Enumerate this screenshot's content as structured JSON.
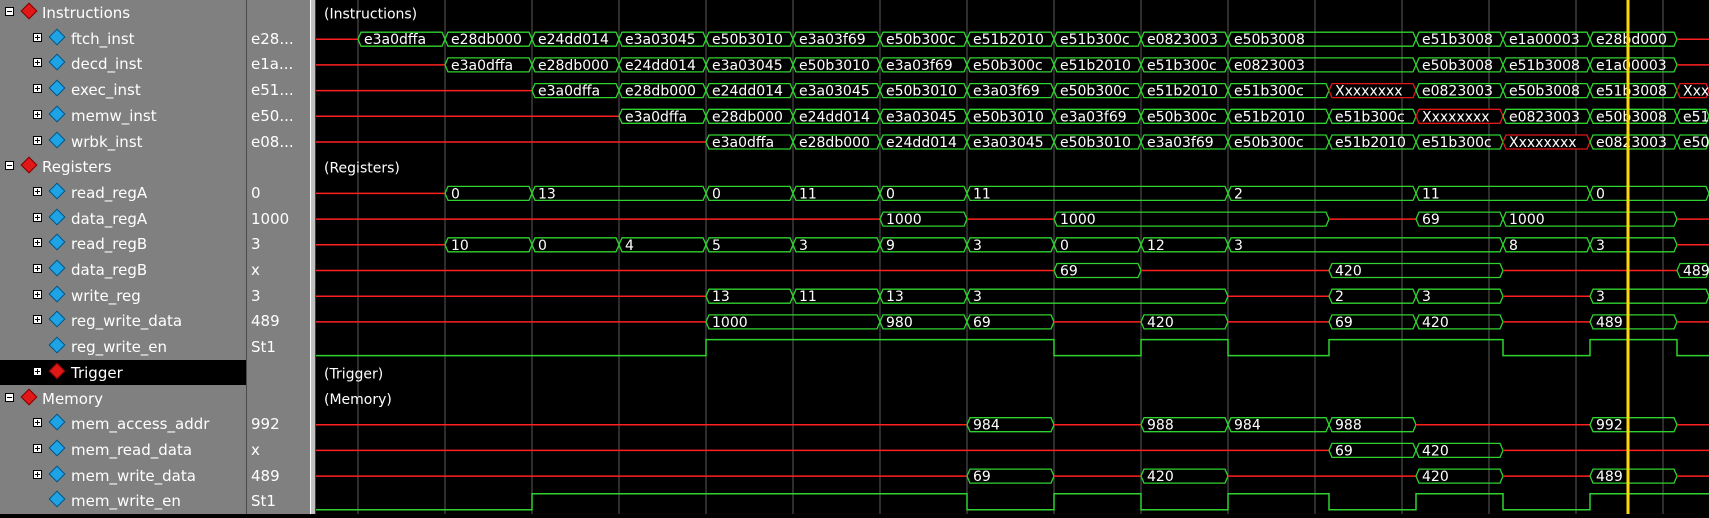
{
  "groups": {
    "instructions": "Instructions",
    "registers": "Registers",
    "trigger": "Trigger",
    "memory": "Memory"
  },
  "wave_labels": {
    "instructions": "(Instructions)",
    "registers": "(Registers)",
    "trigger": "(Trigger)",
    "memory": "(Memory)"
  },
  "signals": {
    "ftch_inst": {
      "name": "ftch_inst",
      "value": "e28...",
      "segments": [
        {
          "start": 42,
          "end": 129,
          "text": "e3a0dffa"
        },
        {
          "start": 129,
          "end": 216,
          "text": "e28db000"
        },
        {
          "start": 216,
          "end": 303,
          "text": "e24dd014"
        },
        {
          "start": 303,
          "end": 390,
          "text": "e3a03045"
        },
        {
          "start": 390,
          "end": 477,
          "text": "e50b3010"
        },
        {
          "start": 477,
          "end": 564,
          "text": "e3a03f69"
        },
        {
          "start": 564,
          "end": 651,
          "text": "e50b300c"
        },
        {
          "start": 651,
          "end": 738,
          "text": "e51b2010"
        },
        {
          "start": 738,
          "end": 825,
          "text": "e51b300c"
        },
        {
          "start": 825,
          "end": 912,
          "text": "e0823003"
        },
        {
          "start": 912,
          "end": 1100,
          "text": "e50b3008"
        },
        {
          "start": 1100,
          "end": 1187,
          "text": "e51b3008"
        },
        {
          "start": 1187,
          "end": 1274,
          "text": "e1a00003"
        },
        {
          "start": 1274,
          "end": 1361,
          "text": "e28bd000"
        }
      ]
    },
    "decd_inst": {
      "name": "decd_inst",
      "value": "e1a...",
      "segments": [
        {
          "start": 129,
          "end": 216,
          "text": "e3a0dffa"
        },
        {
          "start": 216,
          "end": 303,
          "text": "e28db000"
        },
        {
          "start": 303,
          "end": 390,
          "text": "e24dd014"
        },
        {
          "start": 390,
          "end": 477,
          "text": "e3a03045"
        },
        {
          "start": 477,
          "end": 564,
          "text": "e50b3010"
        },
        {
          "start": 564,
          "end": 651,
          "text": "e3a03f69"
        },
        {
          "start": 651,
          "end": 738,
          "text": "e50b300c"
        },
        {
          "start": 738,
          "end": 825,
          "text": "e51b2010"
        },
        {
          "start": 825,
          "end": 912,
          "text": "e51b300c"
        },
        {
          "start": 912,
          "end": 1100,
          "text": "e0823003"
        },
        {
          "start": 1100,
          "end": 1187,
          "text": "e50b3008"
        },
        {
          "start": 1187,
          "end": 1274,
          "text": "e51b3008"
        },
        {
          "start": 1274,
          "end": 1361,
          "text": "e1a00003"
        }
      ]
    },
    "exec_inst": {
      "name": "exec_inst",
      "value": "e51...",
      "segments": [
        {
          "start": 216,
          "end": 303,
          "text": "e3a0dffa"
        },
        {
          "start": 303,
          "end": 390,
          "text": "e28db000"
        },
        {
          "start": 390,
          "end": 477,
          "text": "e24dd014"
        },
        {
          "start": 477,
          "end": 564,
          "text": "e3a03045"
        },
        {
          "start": 564,
          "end": 651,
          "text": "e50b3010"
        },
        {
          "start": 651,
          "end": 738,
          "text": "e3a03f69"
        },
        {
          "start": 738,
          "end": 825,
          "text": "e50b300c"
        },
        {
          "start": 825,
          "end": 912,
          "text": "e51b2010"
        },
        {
          "start": 912,
          "end": 1013,
          "text": "e51b300c"
        },
        {
          "start": 1013,
          "end": 1100,
          "text": "Xxxxxxxx",
          "x": true
        },
        {
          "start": 1100,
          "end": 1187,
          "text": "e0823003"
        },
        {
          "start": 1187,
          "end": 1274,
          "text": "e50b3008"
        },
        {
          "start": 1274,
          "end": 1361,
          "text": "e51b3008"
        },
        {
          "start": 1361,
          "end": 1393,
          "text": "Xxxxxxxx",
          "x": true
        }
      ]
    },
    "memw_inst": {
      "name": "memw_inst",
      "value": "e50...",
      "segments": [
        {
          "start": 303,
          "end": 390,
          "text": "e3a0dffa"
        },
        {
          "start": 390,
          "end": 477,
          "text": "e28db000"
        },
        {
          "start": 477,
          "end": 564,
          "text": "e24dd014"
        },
        {
          "start": 564,
          "end": 651,
          "text": "e3a03045"
        },
        {
          "start": 651,
          "end": 738,
          "text": "e50b3010"
        },
        {
          "start": 738,
          "end": 825,
          "text": "e3a03f69"
        },
        {
          "start": 825,
          "end": 912,
          "text": "e50b300c"
        },
        {
          "start": 912,
          "end": 1013,
          "text": "e51b2010"
        },
        {
          "start": 1013,
          "end": 1100,
          "text": "e51b300c"
        },
        {
          "start": 1100,
          "end": 1187,
          "text": "Xxxxxxxx",
          "x": true
        },
        {
          "start": 1187,
          "end": 1274,
          "text": "e0823003"
        },
        {
          "start": 1274,
          "end": 1361,
          "text": "e50b3008"
        },
        {
          "start": 1361,
          "end": 1393,
          "text": "e51b3008"
        }
      ]
    },
    "wrbk_inst": {
      "name": "wrbk_inst",
      "value": "e08...",
      "segments": [
        {
          "start": 390,
          "end": 477,
          "text": "e3a0dffa"
        },
        {
          "start": 477,
          "end": 564,
          "text": "e28db000"
        },
        {
          "start": 564,
          "end": 651,
          "text": "e24dd014"
        },
        {
          "start": 651,
          "end": 738,
          "text": "e3a03045"
        },
        {
          "start": 738,
          "end": 825,
          "text": "e50b3010"
        },
        {
          "start": 825,
          "end": 912,
          "text": "e3a03f69"
        },
        {
          "start": 912,
          "end": 1013,
          "text": "e50b300c"
        },
        {
          "start": 1013,
          "end": 1100,
          "text": "e51b2010"
        },
        {
          "start": 1100,
          "end": 1187,
          "text": "e51b300c"
        },
        {
          "start": 1187,
          "end": 1274,
          "text": "Xxxxxxxx",
          "x": true
        },
        {
          "start": 1274,
          "end": 1361,
          "text": "e0823003"
        },
        {
          "start": 1361,
          "end": 1393,
          "text": "e50b3008"
        }
      ]
    },
    "read_regA": {
      "name": "read_regA",
      "value": "0",
      "segments": [
        {
          "start": 129,
          "end": 216,
          "text": "0"
        },
        {
          "start": 216,
          "end": 390,
          "text": "13"
        },
        {
          "start": 390,
          "end": 477,
          "text": "0"
        },
        {
          "start": 477,
          "end": 564,
          "text": "11"
        },
        {
          "start": 564,
          "end": 651,
          "text": "0"
        },
        {
          "start": 651,
          "end": 912,
          "text": "11"
        },
        {
          "start": 912,
          "end": 1100,
          "text": "2"
        },
        {
          "start": 1100,
          "end": 1274,
          "text": "11"
        },
        {
          "start": 1274,
          "end": 1393,
          "text": "0"
        }
      ]
    },
    "data_regA": {
      "name": "data_regA",
      "value": "1000",
      "segments": [
        {
          "start": 564,
          "end": 651,
          "text": "1000"
        },
        {
          "start": 738,
          "end": 1013,
          "text": "1000"
        },
        {
          "start": 1100,
          "end": 1187,
          "text": "69"
        },
        {
          "start": 1187,
          "end": 1361,
          "text": "1000"
        }
      ]
    },
    "read_regB": {
      "name": "read_regB",
      "value": "3",
      "segments": [
        {
          "start": 129,
          "end": 216,
          "text": "10"
        },
        {
          "start": 216,
          "end": 303,
          "text": "0"
        },
        {
          "start": 303,
          "end": 390,
          "text": "4"
        },
        {
          "start": 390,
          "end": 477,
          "text": "5"
        },
        {
          "start": 477,
          "end": 564,
          "text": "3"
        },
        {
          "start": 564,
          "end": 651,
          "text": "9"
        },
        {
          "start": 651,
          "end": 738,
          "text": "3"
        },
        {
          "start": 738,
          "end": 825,
          "text": "0"
        },
        {
          "start": 825,
          "end": 912,
          "text": "12"
        },
        {
          "start": 912,
          "end": 1187,
          "text": "3"
        },
        {
          "start": 1187,
          "end": 1274,
          "text": "8"
        },
        {
          "start": 1274,
          "end": 1361,
          "text": "3"
        }
      ]
    },
    "data_regB": {
      "name": "data_regB",
      "value": "x",
      "segments": [
        {
          "start": 738,
          "end": 825,
          "text": "69"
        },
        {
          "start": 1013,
          "end": 1187,
          "text": "420"
        },
        {
          "start": 1361,
          "end": 1393,
          "text": "489"
        }
      ]
    },
    "write_reg": {
      "name": "write_reg",
      "value": "3",
      "segments": [
        {
          "start": 390,
          "end": 477,
          "text": "13"
        },
        {
          "start": 477,
          "end": 564,
          "text": "11"
        },
        {
          "start": 564,
          "end": 651,
          "text": "13"
        },
        {
          "start": 651,
          "end": 912,
          "text": "3"
        },
        {
          "start": 1013,
          "end": 1100,
          "text": "2"
        },
        {
          "start": 1100,
          "end": 1187,
          "text": "3"
        },
        {
          "start": 1274,
          "end": 1393,
          "text": "3"
        }
      ]
    },
    "reg_write_data": {
      "name": "reg_write_data",
      "value": "489",
      "segments": [
        {
          "start": 390,
          "end": 564,
          "text": "1000"
        },
        {
          "start": 564,
          "end": 651,
          "text": "980"
        },
        {
          "start": 651,
          "end": 738,
          "text": "69"
        },
        {
          "start": 825,
          "end": 912,
          "text": "420"
        },
        {
          "start": 1013,
          "end": 1100,
          "text": "69"
        },
        {
          "start": 1100,
          "end": 1187,
          "text": "420"
        },
        {
          "start": 1274,
          "end": 1361,
          "text": "489"
        }
      ]
    },
    "reg_write_en": {
      "name": "reg_write_en",
      "value": "St1",
      "high": [
        {
          "start": 390,
          "end": 738
        },
        {
          "start": 825,
          "end": 912
        },
        {
          "start": 1013,
          "end": 1187
        },
        {
          "start": 1274,
          "end": 1361
        }
      ]
    },
    "trigger": {
      "name": "Trigger"
    },
    "mem_access_addr": {
      "name": "mem_access_addr",
      "value": "992",
      "segments": [
        {
          "start": 651,
          "end": 738,
          "text": "984"
        },
        {
          "start": 825,
          "end": 912,
          "text": "988"
        },
        {
          "start": 912,
          "end": 1013,
          "text": "984"
        },
        {
          "start": 1013,
          "end": 1100,
          "text": "988"
        },
        {
          "start": 1274,
          "end": 1361,
          "text": "992"
        }
      ]
    },
    "mem_read_data": {
      "name": "mem_read_data",
      "value": "x",
      "segments": [
        {
          "start": 1013,
          "end": 1100,
          "text": "69"
        },
        {
          "start": 1100,
          "end": 1187,
          "text": "420"
        }
      ]
    },
    "mem_write_data": {
      "name": "mem_write_data",
      "value": "489",
      "segments": [
        {
          "start": 651,
          "end": 738,
          "text": "69"
        },
        {
          "start": 825,
          "end": 912,
          "text": "420"
        },
        {
          "start": 1100,
          "end": 1187,
          "text": "420"
        },
        {
          "start": 1274,
          "end": 1361,
          "text": "489"
        }
      ]
    },
    "mem_write_en": {
      "name": "mem_write_en",
      "value": "St1",
      "high": [
        {
          "start": 216,
          "end": 651
        },
        {
          "start": 738,
          "end": 825
        },
        {
          "start": 912,
          "end": 1013
        },
        {
          "start": 1100,
          "end": 1187
        },
        {
          "start": 1274,
          "end": 1393
        }
      ]
    }
  },
  "colors": {
    "valid": "#2fd32f",
    "undefined": "#ff2020",
    "x_state": "#e01818",
    "cursor": "#ffd800",
    "grid": "#5a5a5a",
    "label": "#ffffff"
  }
}
